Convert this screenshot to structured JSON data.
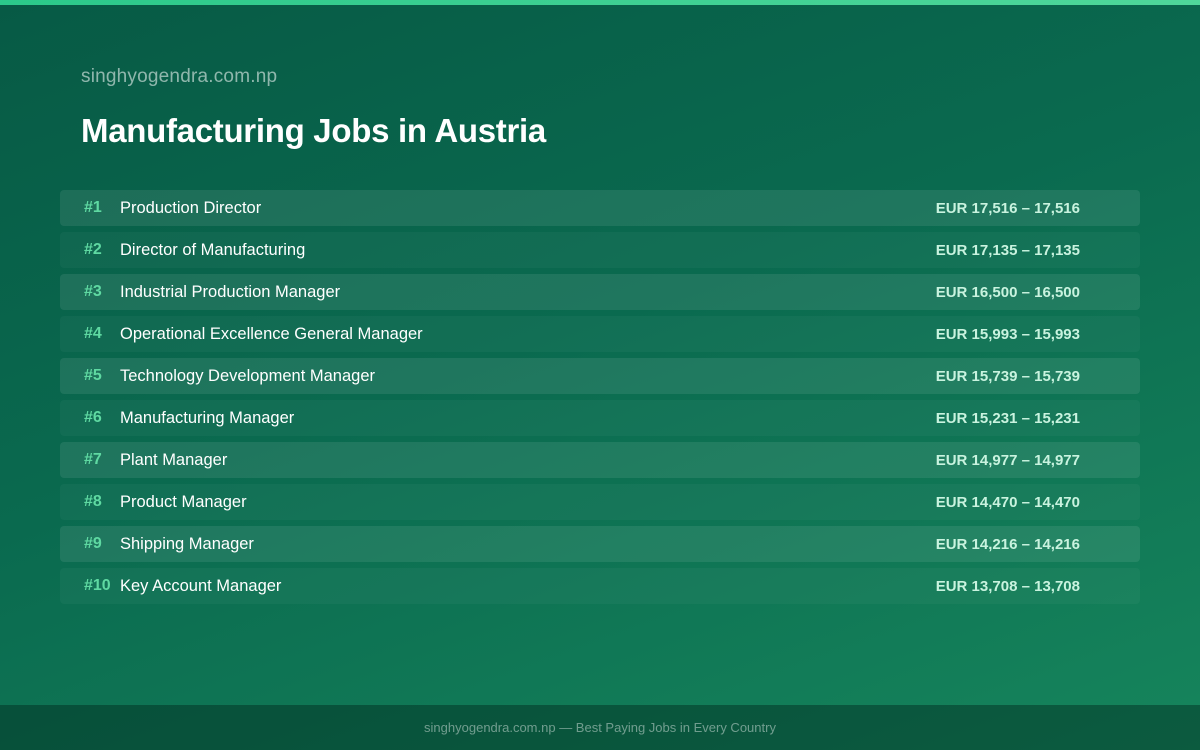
{
  "header": {
    "site_name": "singhyogendra.com.np",
    "title": "Manufacturing Jobs in Austria"
  },
  "jobs": [
    {
      "rank": "#1",
      "title": "Production Director",
      "salary": "EUR 17,516 – 17,516"
    },
    {
      "rank": "#2",
      "title": "Director of Manufacturing",
      "salary": "EUR 17,135 – 17,135"
    },
    {
      "rank": "#3",
      "title": "Industrial Production Manager",
      "salary": "EUR 16,500 – 16,500"
    },
    {
      "rank": "#4",
      "title": "Operational Excellence General Manager",
      "salary": "EUR 15,993 – 15,993"
    },
    {
      "rank": "#5",
      "title": "Technology Development Manager",
      "salary": "EUR 15,739 – 15,739"
    },
    {
      "rank": "#6",
      "title": "Manufacturing Manager",
      "salary": "EUR 15,231 – 15,231"
    },
    {
      "rank": "#7",
      "title": "Plant Manager",
      "salary": "EUR 14,977 – 14,977"
    },
    {
      "rank": "#8",
      "title": "Product Manager",
      "salary": "EUR 14,470 – 14,470"
    },
    {
      "rank": "#9",
      "title": "Shipping Manager",
      "salary": "EUR 14,216 – 14,216"
    },
    {
      "rank": "#10",
      "title": "Key Account Manager",
      "salary": "EUR 13,708 – 13,708"
    }
  ],
  "footer": {
    "text": "singhyogendra.com.np — Best Paying Jobs in Every Country"
  },
  "colors": {
    "accent": "#2bc98a",
    "rank": "#5fd9a2",
    "salary": "#c9f3df",
    "background": "#0a6a4f"
  }
}
